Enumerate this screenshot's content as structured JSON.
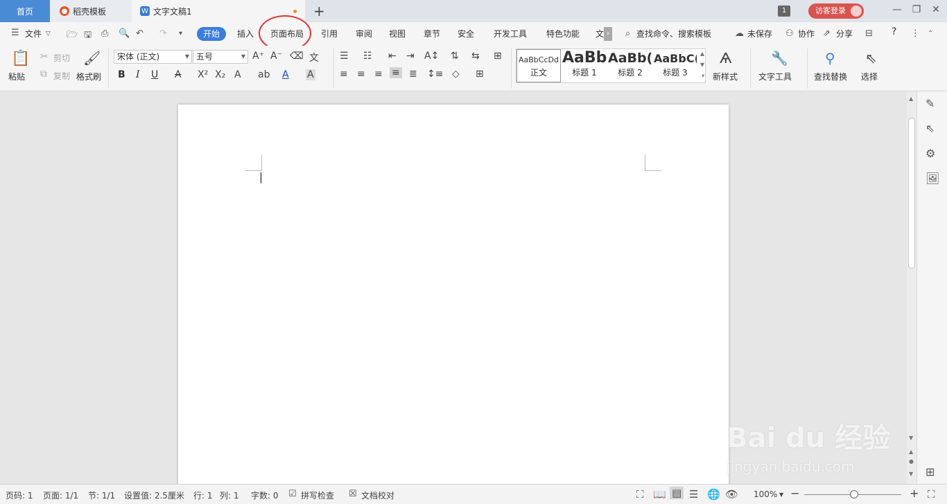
{
  "tabs": {
    "home": "首页",
    "template": "稻壳模板",
    "document": "文字文稿1",
    "add": "+"
  },
  "window": {
    "badge": "1",
    "login": "访客登录",
    "minimize": "—",
    "restore": "❐",
    "close": "✕"
  },
  "menu": {
    "file": "文件",
    "start": "开始",
    "insert": "插入",
    "page_layout": "页面布局",
    "references": "引用",
    "review": "审阅",
    "view": "视图",
    "section": "章节",
    "security": "安全",
    "developer": "开发工具",
    "features": "特色功能",
    "more_truncated": "文",
    "search": "查找命令、搜索模板",
    "unsaved": "未保存",
    "collaborate": "协作",
    "share": "分享",
    "help": "?"
  },
  "ribbon": {
    "paste": "粘贴",
    "cut": "剪切",
    "copy": "复制",
    "format_painter": "格式刷",
    "font_name": "宋体 (正文)",
    "font_size": "五号",
    "bold": "B",
    "italic": "I",
    "underline": "U",
    "styles": [
      {
        "sample": "AaBbCcDd",
        "name": "正文"
      },
      {
        "sample": "AaBb",
        "name": "标题 1"
      },
      {
        "sample": "AaBb(",
        "name": "标题 2"
      },
      {
        "sample": "AaBbC(",
        "name": "标题 3"
      }
    ],
    "new_style": "新样式",
    "text_tools": "文字工具",
    "find_replace": "查找替换",
    "select": "选择"
  },
  "status": {
    "page_no": "页码: 1",
    "pages": "页面: 1/1",
    "section": "节: 1/1",
    "setting": "设置值: 2.5厘米",
    "row": "行: 1",
    "col": "列: 1",
    "word_count": "字数: 0",
    "spell_check": "拼写检查",
    "doc_proof": "文档校对",
    "zoom": "100%"
  },
  "watermark": {
    "main": "Bai du 经验",
    "sub": "jingyan.baidu.com"
  },
  "colors": {
    "accent": "#3b7ddd",
    "highlight_ring": "#e63232",
    "login_bg": "#d9534f"
  }
}
